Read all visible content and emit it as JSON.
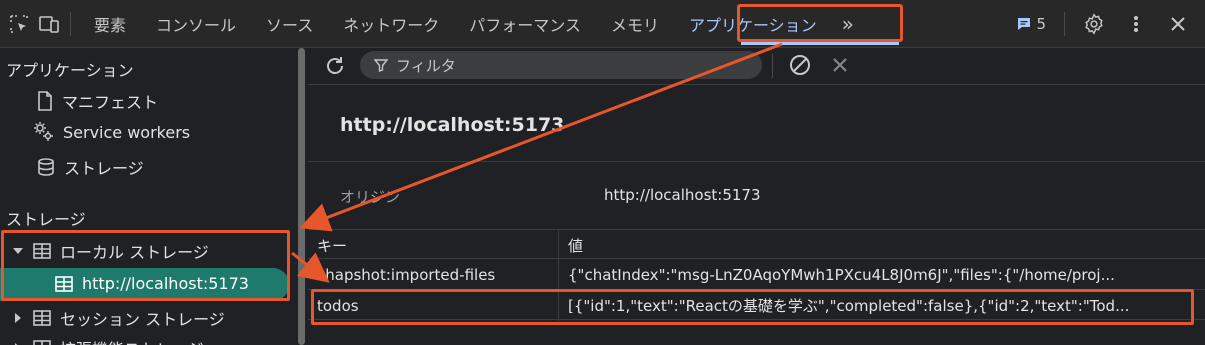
{
  "tabs": {
    "elements": "要素",
    "console": "コンソール",
    "sources": "ソース",
    "network": "ネットワーク",
    "performance": "パフォーマンス",
    "memory": "メモリ",
    "application": "アプリケーション",
    "more": "»"
  },
  "issues_count": "5",
  "sidebar": {
    "application_heading": "アプリケーション",
    "manifest": "マニフェスト",
    "service_workers": "Service workers",
    "storage_item": "ストレージ",
    "storage_heading": "ストレージ",
    "local_storage": "ローカル ストレージ",
    "local_storage_origin": "http://localhost:5173",
    "session_storage": "セッション ストレージ",
    "extension_storage": "拡張機能ストレージ"
  },
  "toolbar": {
    "filter_placeholder": "フィルタ"
  },
  "origin": {
    "title": "http://localhost:5173",
    "label": "オリジン",
    "value": "http://localhost:5173"
  },
  "table": {
    "headers": {
      "key": "キー",
      "value": "値"
    },
    "rows": [
      {
        "key": "chapshot:imported-files",
        "value": "{\"chatIndex\":\"msg-LnZ0AqoYMwh1PXcu4L8J0m6J\",\"files\":{\"/home/proj..."
      },
      {
        "key": "todos",
        "value": "[{\"id\":1,\"text\":\"Reactの基礎を学ぶ\",\"completed\":false},{\"id\":2,\"text\":\"Tod..."
      }
    ]
  },
  "colors": {
    "accent": "#a8c7fa",
    "highlight_box": "#e8562b",
    "selected_bg": "#1f7a6e"
  }
}
